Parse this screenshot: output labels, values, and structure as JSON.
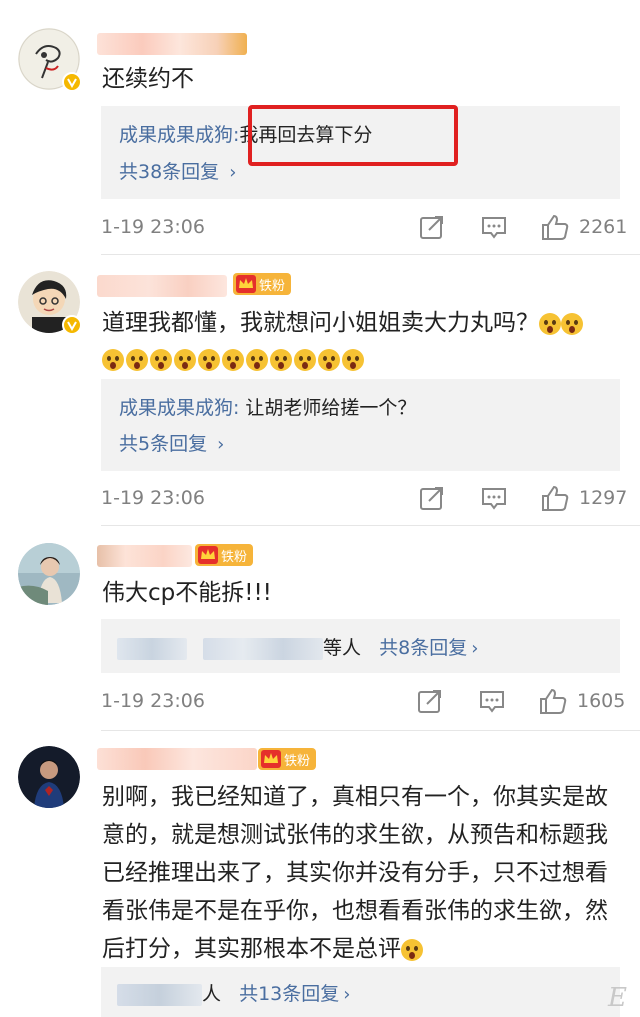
{
  "comments": [
    {
      "text": "还续约不",
      "reply_preview": {
        "author": "成果成果成狗:",
        "text": "我再回去算下分"
      },
      "more_replies": "共38条回复",
      "time": "1-19 23:06",
      "likes": "2261"
    },
    {
      "fan_badge": "铁粉",
      "text_main": "道理我都懂，我就想问小姐姐卖大力丸吗？",
      "reply_preview": {
        "author": "成果成果成狗:",
        "text": "让胡老师给搓一个？"
      },
      "more_replies": "共5条回复",
      "time": "1-19 23:06",
      "likes": "1297"
    },
    {
      "fan_badge": "铁粉",
      "text": "伟大cp不能拆!!!",
      "reply_suffix": "等人",
      "more_replies": "共8条回复",
      "time": "1-19 23:06",
      "likes": "1605"
    },
    {
      "fan_badge": "铁粉",
      "text": "别啊，我已经知道了，真相只有一个，你其实是故意的，就是想测试张伟的求生欲，从预告和标题我已经推理出来了，其实你并没有分手，只不过想看看张伟是不是在乎你，也想看看张伟的求生欲，然后打分，其实那根本不是总评",
      "reply_suffix": "人",
      "more_replies": "共13条回复"
    }
  ],
  "icons": {
    "share": "share-icon",
    "comment": "comment-icon",
    "like": "thumbs-up-icon",
    "more": "chevron-right-icon",
    "verified": "verified-badge-icon",
    "fan": "crown-icon",
    "emoji": "screaming-face-emoji"
  },
  "colors": {
    "link": "#4a6ea0",
    "highlight": "#e02020",
    "fan_badge": "#f6b43a",
    "verified": "#f5b800"
  },
  "watermark": "E"
}
